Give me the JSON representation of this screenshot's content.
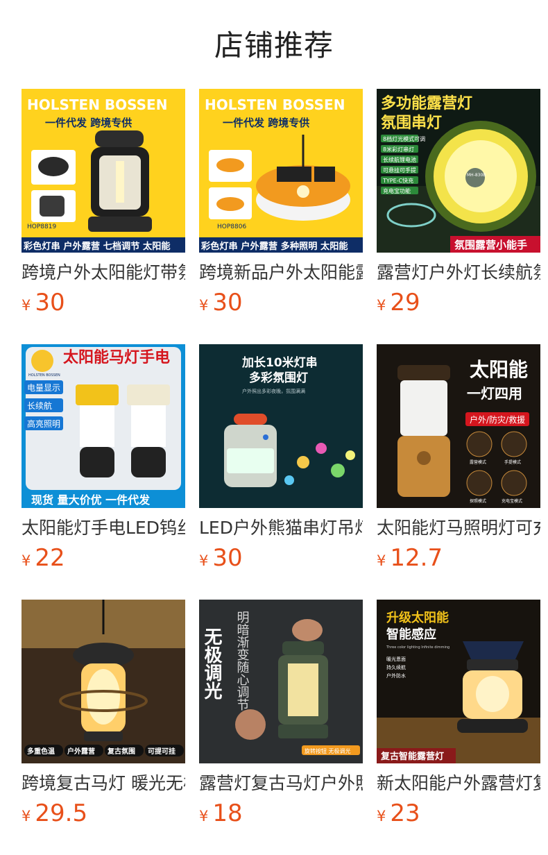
{
  "header": {
    "title": "店铺推荐"
  },
  "products": [
    {
      "name": "跨境户外太阳能灯带氛围露营灯",
      "currency": "¥",
      "price": "30",
      "image": {
        "brand": "HOLSTEN BOSSEN",
        "tagline": "一件代发 跨境专供",
        "model": "HOP8819",
        "caption": "彩色灯串 户外露营 七档调节 太阳能"
      }
    },
    {
      "name": "跨境新品户外太阳能露营灯",
      "currency": "¥",
      "price": "30",
      "image": {
        "brand": "HOLSTEN BOSSEN",
        "tagline": "一件代发 跨境专供",
        "model": "HOP8806",
        "caption": "彩色灯串 户外露营 多种照明 太阳能"
      }
    },
    {
      "name": "露营灯户外灯长续航氛围灯",
      "currency": "¥",
      "price": "29",
      "image": {
        "heading_1": "多功能露营灯",
        "heading_2": "氛围串灯",
        "bullets": [
          "8档灯光模式可调",
          "8米彩灯串灯",
          "长续航锂电池",
          "可悬挂可手提",
          "TYPE-C快充",
          "充电宝功能"
        ],
        "badge": "MH-830B",
        "caption": "氛围露营小能手"
      }
    },
    {
      "name": "太阳能灯手电LED钨丝马灯",
      "currency": "¥",
      "price": "22",
      "image": {
        "heading": "太阳能马灯手电",
        "logo_text": "HOLSTEN BOSSEN",
        "tags": [
          "电量显示",
          "长续航",
          "高亮照明"
        ],
        "caption": "现货 量大价优 一件代发"
      }
    },
    {
      "name": "LED户外熊猫串灯吊灯露营灯",
      "currency": "¥",
      "price": "30",
      "image": {
        "heading_1": "加长10米灯串",
        "heading_2": "多彩氛围灯",
        "subtitle": "户外照出多彩夜晚，氛围满满"
      }
    },
    {
      "name": "太阳能灯马照明灯可充电",
      "currency": "¥",
      "price": "12.7",
      "image": {
        "heading_1": "太阳能",
        "heading_2": "一灯四用",
        "tag": "户外/防灾/救援",
        "modes": [
          "露营模式",
          "手提模式",
          "探照模式",
          "充电宝模式"
        ]
      }
    },
    {
      "name": "跨境复古马灯 暖光无极调光",
      "currency": "¥",
      "price": "29.5",
      "image": {
        "tags": [
          "多重色温",
          "户外露营",
          "复古氛围",
          "可提可挂"
        ]
      }
    },
    {
      "name": "露营灯复古马灯户外照明灯",
      "currency": "¥",
      "price": "18",
      "image": {
        "heading": "无极调光",
        "vertical_text": "明暗渐变随心调节",
        "caption": "旋转按钮 无极调光"
      }
    },
    {
      "name": "新太阳能户外露营灯复古马灯",
      "currency": "¥",
      "price": "23",
      "image": {
        "heading_1": "升级太阳能",
        "heading_2": "智能感应",
        "subtitle": "Three color lighting Infinite dimming",
        "bullets": [
          "暖光恩面",
          "持久续航",
          "户外防水"
        ],
        "caption": "复古智能露营灯"
      }
    }
  ],
  "colors": {
    "price": "#e8501a",
    "yellow": "#ffd21e",
    "navy": "#0e2d66"
  }
}
